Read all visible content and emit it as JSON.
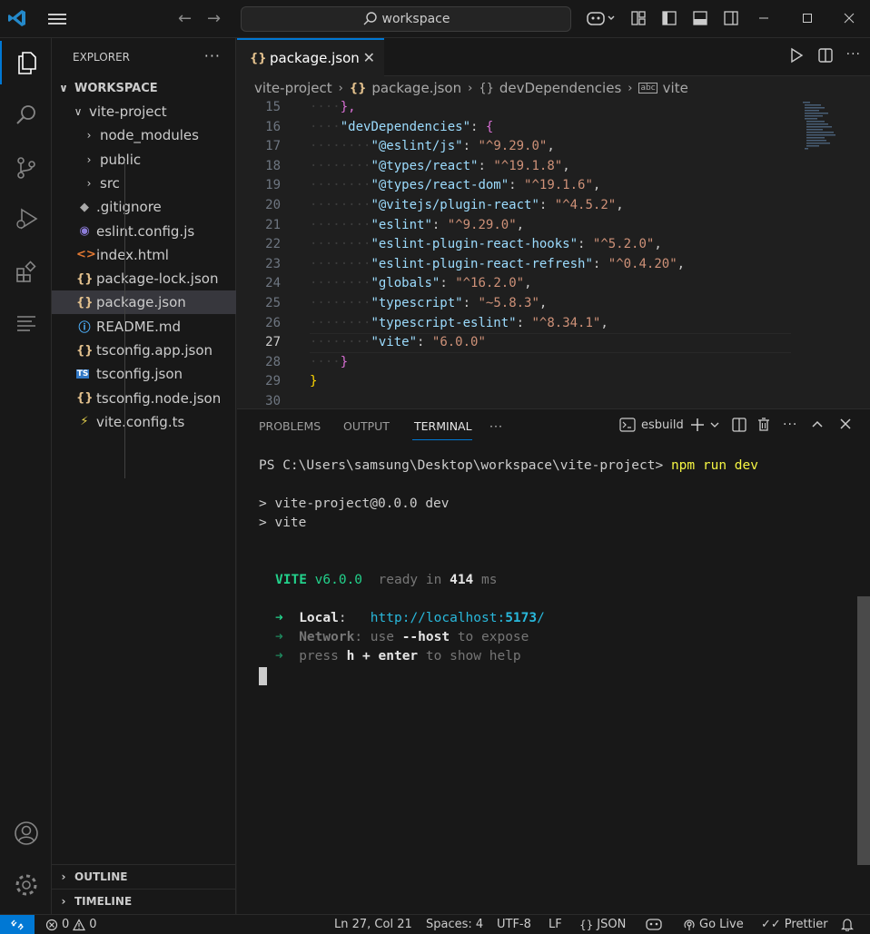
{
  "titlebar": {
    "search_text": "workspace",
    "icons": [
      "vscode-logo",
      "menu-icon",
      "back-arrow-icon",
      "forward-arrow-icon",
      "copilot-icon",
      "customize-layout-icon",
      "toggle-sidebar-icon",
      "toggle-panel-icon",
      "toggle-secondary-sidebar-icon",
      "minimize-icon",
      "maximize-icon",
      "close-icon"
    ]
  },
  "activitybar": {
    "items": [
      "explorer-icon",
      "search-icon",
      "source-control-icon",
      "run-debug-icon",
      "extensions-icon",
      "outline-icon"
    ],
    "bottom": [
      "accounts-icon",
      "manage-gear-icon"
    ]
  },
  "sidebar": {
    "title": "EXPLORER",
    "more": "···",
    "workspace_label": "WORKSPACE",
    "tree": [
      {
        "label": "vite-project",
        "kind": "folder-open",
        "icon": ""
      },
      {
        "label": "node_modules",
        "kind": "folder",
        "icon": ""
      },
      {
        "label": "public",
        "kind": "folder",
        "icon": ""
      },
      {
        "label": "src",
        "kind": "folder",
        "icon": ""
      },
      {
        "label": ".gitignore",
        "kind": "file",
        "icon": "◆"
      },
      {
        "label": "eslint.config.js",
        "kind": "file",
        "icon": "◉"
      },
      {
        "label": "index.html",
        "kind": "file",
        "icon": "<>"
      },
      {
        "label": "package-lock.json",
        "kind": "file",
        "icon": "{}"
      },
      {
        "label": "package.json",
        "kind": "file",
        "icon": "{}"
      },
      {
        "label": "README.md",
        "kind": "file",
        "icon": "ⓘ"
      },
      {
        "label": "tsconfig.app.json",
        "kind": "file",
        "icon": "{}"
      },
      {
        "label": "tsconfig.json",
        "kind": "file",
        "icon": "TS"
      },
      {
        "label": "tsconfig.node.json",
        "kind": "file",
        "icon": "{}"
      },
      {
        "label": "vite.config.ts",
        "kind": "file",
        "icon": "⚡"
      }
    ],
    "outline_label": "OUTLINE",
    "timeline_label": "TIMELINE"
  },
  "editor": {
    "tab_icon": "{}",
    "tab_label": "package.json",
    "breadcrumb": [
      "vite-project",
      "package.json",
      "devDependencies",
      "vite"
    ],
    "breadcrumb_icons": [
      "{}",
      "{}",
      "abc"
    ],
    "lines": [
      {
        "n": "15",
        "text": "},",
        "indent": 1
      },
      {
        "n": "16",
        "key": "devDependencies",
        "brace": "{",
        "indent": 1
      },
      {
        "n": "17",
        "key": "@eslint/js",
        "val": "^9.29.0",
        "comma": ",",
        "indent": 2
      },
      {
        "n": "18",
        "key": "@types/react",
        "val": "^19.1.8",
        "comma": ",",
        "indent": 2
      },
      {
        "n": "19",
        "key": "@types/react-dom",
        "val": "^19.1.6",
        "comma": ",",
        "indent": 2
      },
      {
        "n": "20",
        "key": "@vitejs/plugin-react",
        "val": "^4.5.2",
        "comma": ",",
        "indent": 2
      },
      {
        "n": "21",
        "key": "eslint",
        "val": "^9.29.0",
        "comma": ",",
        "indent": 2
      },
      {
        "n": "22",
        "key": "eslint-plugin-react-hooks",
        "val": "^5.2.0",
        "comma": ",",
        "indent": 2
      },
      {
        "n": "23",
        "key": "eslint-plugin-react-refresh",
        "val": "^0.4.20",
        "comma": ",",
        "indent": 2
      },
      {
        "n": "24",
        "key": "globals",
        "val": "^16.2.0",
        "comma": ",",
        "indent": 2
      },
      {
        "n": "25",
        "key": "typescript",
        "val": "~5.8.3",
        "comma": ",",
        "indent": 2
      },
      {
        "n": "26",
        "key": "typescript-eslint",
        "val": "^8.34.1",
        "comma": ",",
        "indent": 2
      },
      {
        "n": "27",
        "key": "vite",
        "val": "6.0.0",
        "comma": "",
        "indent": 2
      },
      {
        "n": "28",
        "text": "}",
        "indent": 1
      },
      {
        "n": "29",
        "text": "}",
        "indent": 0
      },
      {
        "n": "30",
        "text": "",
        "indent": 0
      }
    ]
  },
  "panel": {
    "tabs": [
      "PROBLEMS",
      "OUTPUT",
      "TERMINAL"
    ],
    "more": "···",
    "terminal_name": "esbuild",
    "prompt": "PS C:\\Users\\samsung\\Desktop\\workspace\\vite-project>",
    "command": "npm run dev",
    "out1": "> vite-project@0.0.0 dev",
    "out2": "> vite",
    "vite_label": "VITE",
    "vite_version": "v6.0.0",
    "ready_text": "ready in",
    "ready_ms": "414",
    "ms": "ms",
    "arrow": "➜",
    "local_label": "Local",
    "local_colon": ":",
    "local_url_prefix": "http://localhost:",
    "local_port": "5173",
    "local_url_suffix": "/",
    "network_label": "Network",
    "network_text1": ": use",
    "network_flag": "--host",
    "network_text2": "to expose",
    "press_text": "press",
    "press_keys": "h + enter",
    "press_tail": "to show help"
  },
  "statusbar": {
    "errors": "0",
    "warnings": "0",
    "position": "Ln 27, Col 21",
    "spaces": "Spaces: 4",
    "encoding": "UTF-8",
    "eol": "LF",
    "language": "JSON",
    "golive": "Go Live",
    "prettier": "Prettier"
  },
  "colors": {
    "accent": "#0078d4",
    "key": "#9cdcfe",
    "string": "#ce9178",
    "bracket1": "#ffd700",
    "bracket2": "#da70d6",
    "term_green": "#23d18b",
    "term_cyan": "#29b8db"
  }
}
